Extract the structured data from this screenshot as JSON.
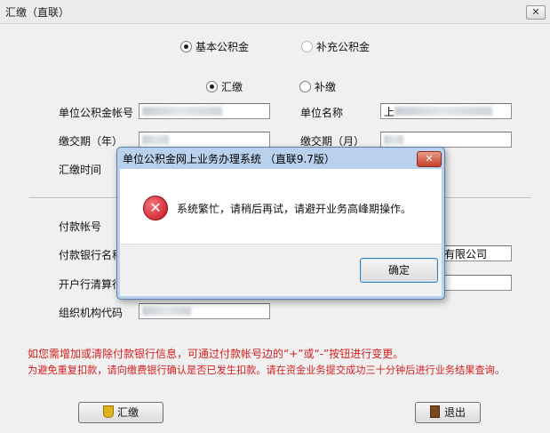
{
  "window": {
    "title": "汇缴（直联）",
    "close_glyph": "✕"
  },
  "fund_type": {
    "basic_label": "基本公积金",
    "supplement_label": "补充公积金"
  },
  "pay_type": {
    "remit_label": "汇缴",
    "makeup_label": "补缴"
  },
  "form": {
    "unit_account_label": "单位公积金帐号",
    "unit_name_label": "单位名称",
    "unit_name_prefix": "上",
    "pay_year_label": "缴交期（年）",
    "pay_month_label": "缴交期（月）",
    "remit_time_label": "汇缴时间",
    "pay_account_label": "付款帐号",
    "pay_bank_label": "付款银行名称",
    "pay_bank_value_suffix": "有限公司",
    "clearing_label": "开户行清算行",
    "org_code_label": "组织机构代码"
  },
  "notes": {
    "line1": "如您需增加或清除付款银行信息，可通过付款帐号边的“+”或“-”按钮进行变更。",
    "line2": "为避免重复扣款，请向缴费银行确认是否已发生扣款。请在资金业务提交成功三十分钟后进行业务结果查询。"
  },
  "buttons": {
    "remit": "汇缴",
    "exit": "退出"
  },
  "dialog": {
    "title": "单位公积金网上业务办理系统 （直联9.7版）",
    "message": "系统繁忙，请稍后再试，请避开业务高峰期操作。",
    "ok": "确定",
    "close_glyph": "✕",
    "error_glyph": "✕"
  },
  "colors": {
    "note_red": "#d41e1e",
    "dialog_frame": "#b9d1ec",
    "error_icon": "#c4121b"
  }
}
